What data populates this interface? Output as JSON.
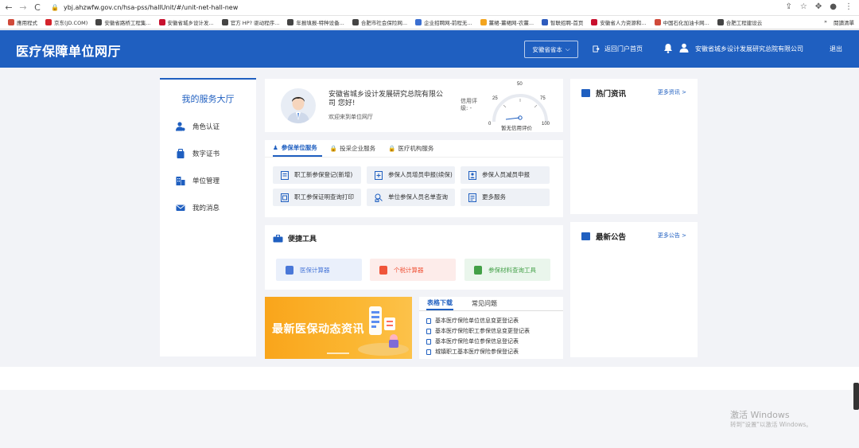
{
  "browser": {
    "back_icon": "←",
    "forward_icon": "→",
    "reload_icon": "C",
    "url": "ybj.ahzwfw.gov.cn/hsa-pss/hallUnit/#/unit-net-hall-new",
    "bookmarks": [
      {
        "label": "應用程式",
        "color": "#d04a3a"
      },
      {
        "label": "京东(JD.COM)",
        "color": "#d4232b"
      },
      {
        "label": "安徽省路桥工程集...",
        "color": "#444444"
      },
      {
        "label": "安徽省城乡设计发...",
        "color": "#c8102e"
      },
      {
        "label": "官方 HP? 驱动程序...",
        "color": "#444444"
      },
      {
        "label": "年报填报-特种设备...",
        "color": "#444444"
      },
      {
        "label": "合肥市社会保险网...",
        "color": "#444444"
      },
      {
        "label": "企业招聘网-前程无...",
        "color": "#3b6fd1"
      },
      {
        "label": "薑桾-薑桾网-农薑...",
        "color": "#f3a41d"
      },
      {
        "label": "智联招聘-首页",
        "color": "#2e5bbd"
      },
      {
        "label": "安徽省人力资源和...",
        "color": "#c8102e"
      },
      {
        "label": "中国石化加油卡网...",
        "color": "#d04a3a"
      },
      {
        "label": "合肥工程建设云",
        "color": "#444444"
      }
    ],
    "bookmarks_more": "»",
    "reading_list": "閱讀清單"
  },
  "header": {
    "logo": "医疗保障单位网厅",
    "province_select": "安徽省省本",
    "portal_link": "返回门户首页",
    "company_name": "安徽省城乡设计发展研究总院有限公司",
    "logout": "退出",
    "accent": "#1f5fc0"
  },
  "sidebar": {
    "title": "我的服务大厅",
    "items": [
      {
        "label": "角色认证",
        "icon": "user-icon"
      },
      {
        "label": "数字证书",
        "icon": "certificate-icon"
      },
      {
        "label": "单位管理",
        "icon": "building-icon"
      },
      {
        "label": "我的消息",
        "icon": "mail-icon"
      }
    ]
  },
  "profile": {
    "company": "安徽省城乡设计发展研究总院有限公司 您好!",
    "welcome": "欢迎来到单位网厅",
    "credit_label": "信用评级: -",
    "gauge_ticks": [
      "0",
      "25",
      "50",
      "75",
      "100"
    ],
    "credit_status": "暂无信用评价"
  },
  "services": {
    "tabs": [
      "参保单位服务",
      "投采企业服务",
      "医疗机构服务"
    ],
    "buttons": [
      {
        "label": "职工新参保登记(新增)",
        "icon": "form-icon"
      },
      {
        "label": "参保人员增员申报(续保)",
        "icon": "add-record-icon"
      },
      {
        "label": "参保人员减员申报",
        "icon": "remove-person-icon"
      },
      {
        "label": "职工参保证明查询打印",
        "icon": "print-icon"
      },
      {
        "label": "单位参保人员名单查询",
        "icon": "search-list-icon"
      },
      {
        "label": "更多服务",
        "icon": "more-services-icon"
      }
    ]
  },
  "tools": {
    "title": "便捷工具",
    "items": [
      {
        "label": "医保计算器",
        "color": "#4a78d8",
        "bg": "#eaf0fb"
      },
      {
        "label": "个税计算器",
        "color": "#f0553a",
        "bg": "#fdecea"
      },
      {
        "label": "参保材料查询工具",
        "color": "#43a047",
        "bg": "#eaf6ec"
      }
    ]
  },
  "banner": {
    "text": "最新医保动态资讯"
  },
  "downloads": {
    "tabs": [
      "表格下载",
      "常见问题"
    ],
    "items": [
      "基本医疗保险单位信息变更登记表",
      "基本医疗保险职工参保信息变更登记表",
      "基本医疗保险单位参保信息登记表",
      "城镇职工基本医疗保险参保登记表"
    ]
  },
  "hot_news": {
    "title": "热门资讯",
    "more": "更多资讯 >"
  },
  "notices": {
    "title": "最新公告",
    "more": "更多公告 >"
  },
  "watermark": {
    "line1": "激活 Windows",
    "line2": "转到\"设置\"以激活 Windows。"
  }
}
